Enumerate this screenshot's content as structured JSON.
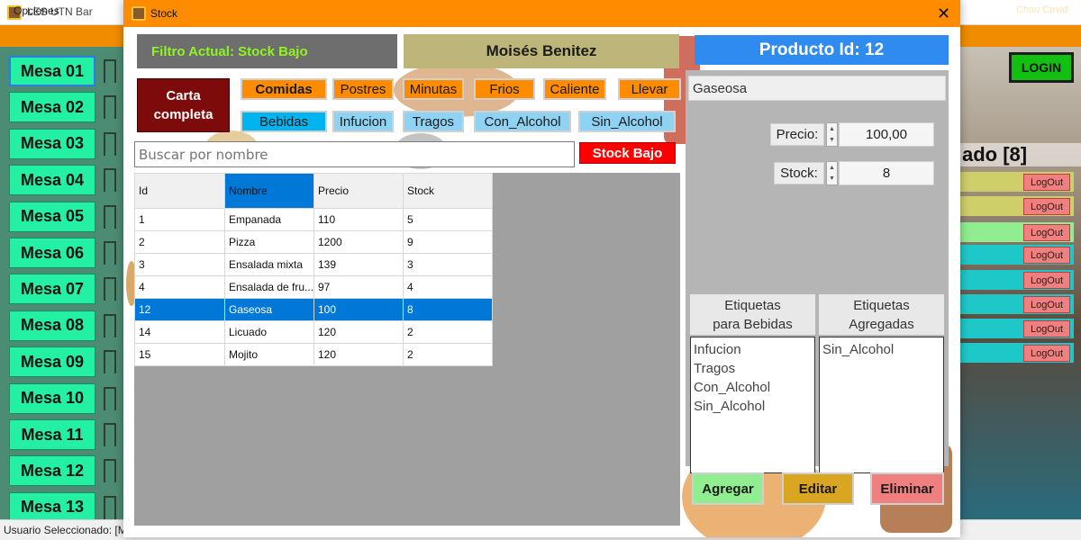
{
  "main_window": {
    "title": "LES UTN Bar",
    "menu": {
      "opciones": "Opciones",
      "right_text": "Chau Covid"
    },
    "mesas": [
      "Mesa 01",
      "Mesa 02",
      "Mesa 03",
      "Mesa 04",
      "Mesa 05",
      "Mesa 06",
      "Mesa 07",
      "Mesa 08",
      "Mesa 09",
      "Mesa 10",
      "Mesa 11",
      "Mesa 12",
      "Mesa 13"
    ],
    "login_label": "LOGIN",
    "right_status": "ado [8]",
    "logout_label": "LogOut",
    "logout_colors": [
      "#cfcf6a",
      "#cfcf6a",
      "#90ee90",
      "#1fc8c8",
      "#1fc8c8",
      "#1fc8c8",
      "#1fc8c8",
      "#1fc8c8"
    ],
    "status_text": "Usuario Seleccionado: [M"
  },
  "stock_window": {
    "title": "Stock",
    "filtro": "Filtro Actual: Stock Bajo",
    "user": "Moisés Benitez",
    "producto_id": "Producto Id: 12",
    "carta_completa": "Carta\ncompleta",
    "categories_row1": [
      "Comidas",
      "Postres",
      "Minutas",
      "Frios",
      "Caliente",
      "Llevar"
    ],
    "categories_row2": [
      "Bebidas",
      "Infucion",
      "Tragos",
      "Con_Alcohol",
      "Sin_Alcohol"
    ],
    "search_placeholder": "Buscar por nombre",
    "stock_bajo_label": "Stock Bajo",
    "grid": {
      "columns": [
        "Id",
        "Nombre",
        "Precio",
        "Stock"
      ],
      "rows": [
        [
          "1",
          "Empanada",
          "110",
          "5"
        ],
        [
          "2",
          "Pizza",
          "1200",
          "9"
        ],
        [
          "3",
          "Ensalada mixta",
          "139",
          "3"
        ],
        [
          "4",
          "Ensalada de fru...",
          "97",
          "4"
        ],
        [
          "12",
          "Gaseosa",
          "100",
          "8"
        ],
        [
          "14",
          "Licuado",
          "120",
          "2"
        ],
        [
          "15",
          "Mojito",
          "120",
          "2"
        ]
      ],
      "selected_row": 4
    },
    "detail": {
      "product_name": "Gaseosa",
      "precio_label": "Precio:",
      "precio_value": "100,00",
      "stock_label": "Stock:",
      "stock_value": "8",
      "tags_available_header": "Etiquetas\npara Bebidas",
      "tags_added_header": "Etiquetas\nAgregadas",
      "tags_available": [
        "Infucion",
        "Tragos",
        "Con_Alcohol",
        "Sin_Alcohol"
      ],
      "tags_added": [
        "Sin_Alcohol"
      ]
    },
    "actions": {
      "agregar": "Agregar",
      "editar": "Editar",
      "eliminar": "Eliminar"
    },
    "colors": {
      "accent_orange": "#ff8c00",
      "selection_blue": "#0078d7",
      "title_blue": "#2f8bf0",
      "danger_red": "#ff0000"
    }
  }
}
